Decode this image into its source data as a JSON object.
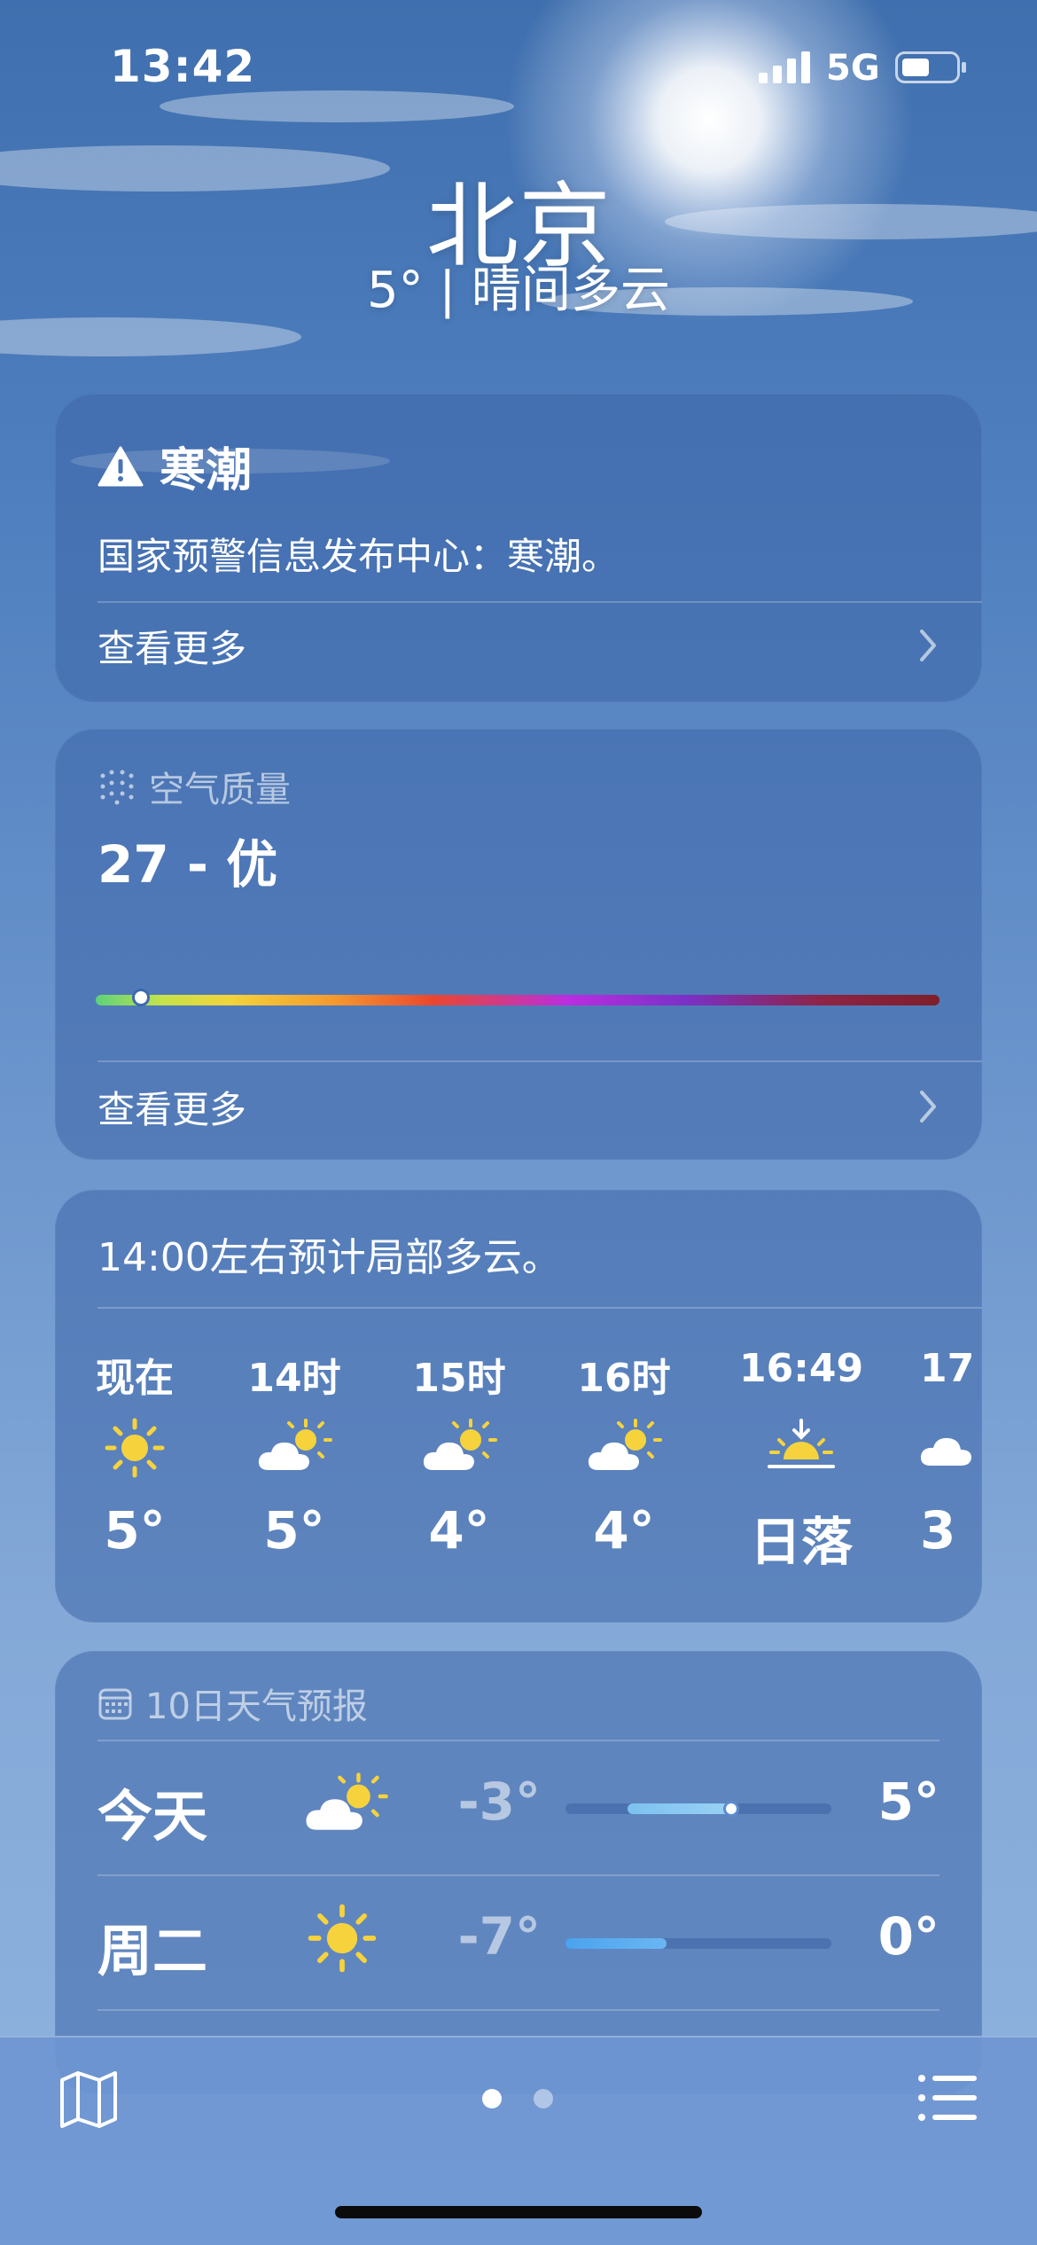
{
  "status": {
    "time": "13:42",
    "network": "5G"
  },
  "location": {
    "city": "北京",
    "summary": "5° | 晴间多云"
  },
  "alert": {
    "title": "寒潮",
    "body": "国家预警信息发布中心：寒潮。",
    "more": "查看更多"
  },
  "air_quality": {
    "header": "空气质量",
    "value_text": "27 - 优",
    "aqi": 27,
    "more": "查看更多"
  },
  "hourly": {
    "summary": "14:00左右预计局部多云。",
    "items": [
      {
        "label": "现在",
        "icon": "sun-icon",
        "temp": "5°"
      },
      {
        "label": "14时",
        "icon": "partly-cloudy-icon",
        "temp": "5°"
      },
      {
        "label": "15时",
        "icon": "partly-cloudy-icon",
        "temp": "4°"
      },
      {
        "label": "16时",
        "icon": "partly-cloudy-icon",
        "temp": "4°"
      },
      {
        "label": "16:49",
        "icon": "sunset-icon",
        "temp": "日落"
      },
      {
        "label": "17",
        "icon": "cloud-icon",
        "temp": "3"
      }
    ]
  },
  "forecast": {
    "header": "10日天气预报",
    "rows": [
      {
        "day": "今天",
        "icon": "partly-cloudy-icon",
        "low": "-3°",
        "high": "5°"
      },
      {
        "day": "周二",
        "icon": "sun-icon",
        "low": "-7°",
        "high": "0°"
      }
    ]
  },
  "colors": {
    "accent": "#f6d33c",
    "aq_good": "#5dd37a"
  }
}
